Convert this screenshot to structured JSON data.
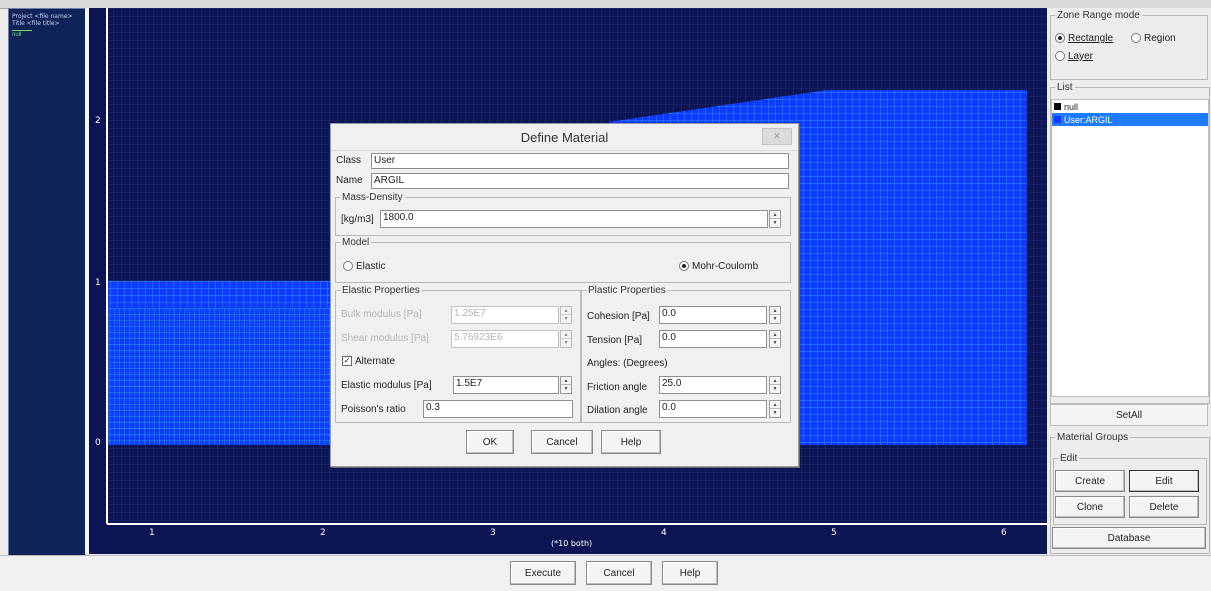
{
  "left_panel": {
    "project_line": "Project <file name>",
    "title_line": "Title <file title>",
    "tag": "null"
  },
  "plot": {
    "x_ticks": [
      "1",
      "2",
      "3",
      "4",
      "5",
      "6"
    ],
    "y_ticks": [
      "2",
      "1",
      "0"
    ],
    "x_axis_label": "(*10 both)"
  },
  "zone_range": {
    "legend": "Zone Range mode",
    "rectangle": "Rectangle",
    "region": "Region",
    "layer": "Layer",
    "selected": "Rectangle"
  },
  "list": {
    "legend": "List",
    "items": [
      {
        "label": "null",
        "color": "#000000"
      },
      {
        "label": "User:ARGIL",
        "color": "#1437ff"
      }
    ]
  },
  "set_all_label": "SetAll",
  "material_groups": {
    "legend": "Material Groups",
    "edit_legend": "Edit",
    "create": "Create",
    "edit": "Edit",
    "clone": "Clone",
    "delete": "Delete",
    "database": "Database"
  },
  "dialog": {
    "title": "Define Material",
    "close_icon": "close-icon",
    "class_label": "Class",
    "class_value": "User",
    "name_label": "Name",
    "name_value": "ARGIL",
    "mass_density": {
      "legend": "Mass-Density",
      "unit_label": "[kg/m3]",
      "value": "1800.0"
    },
    "model": {
      "legend": "Model",
      "elastic": "Elastic",
      "mohr": "Mohr-Coulomb",
      "selected": "Mohr-Coulomb"
    },
    "elastic_props": {
      "legend": "Elastic Properties",
      "bulk_label": "Bulk modulus [Pa]",
      "bulk_value": "1.25E7",
      "shear_label": "Shear modulus [Pa]",
      "shear_value": "5.76923E6",
      "alternate_label": "Alternate",
      "alternate_checked": true,
      "elastic_label": "Elastic modulus [Pa]",
      "elastic_value": "1.5E7",
      "poisson_label": "Poisson's ratio",
      "poisson_value": "0.3"
    },
    "plastic_props": {
      "legend": "Plastic Properties",
      "cohesion_label": "Cohesion [Pa]",
      "cohesion_value": "0.0",
      "tension_label": "Tension [Pa]",
      "tension_value": "0.0",
      "angles_label": "Angles: (Degrees)",
      "friction_label": "Friction angle",
      "friction_value": "25.0",
      "dilation_label": "Dilation angle",
      "dilation_value": "0.0"
    },
    "ok": "OK",
    "cancel": "Cancel",
    "help": "Help"
  },
  "bottom": {
    "execute": "Execute",
    "cancel": "Cancel",
    "help": "Help"
  },
  "colors": {
    "plot_bg": "#0c1453",
    "grid_blue": "#0a3bff",
    "selection": "#1e7bff"
  }
}
